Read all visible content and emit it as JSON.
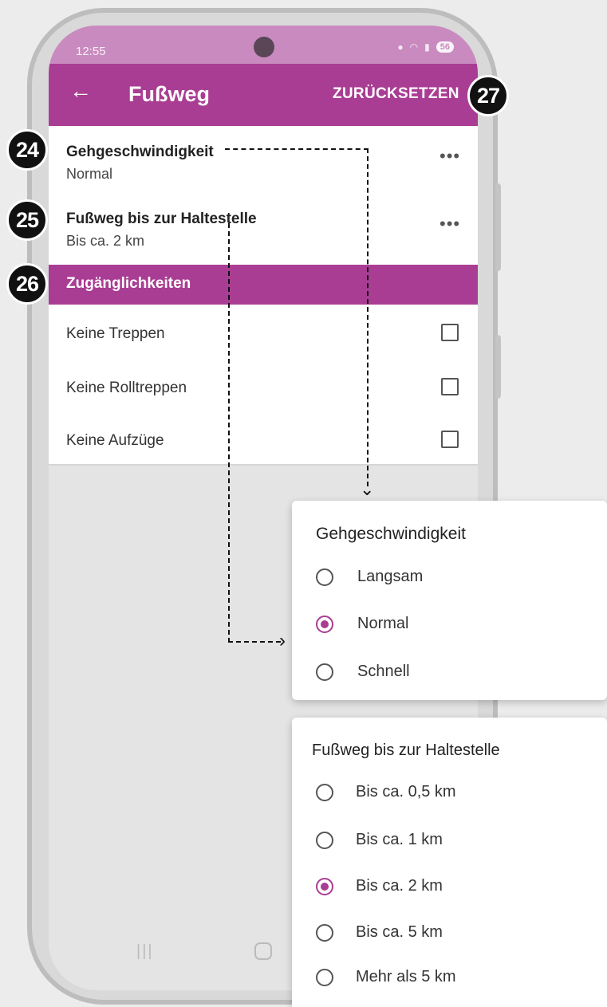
{
  "statusbar": {
    "time": "12:55",
    "battery": "56"
  },
  "appbar": {
    "back_icon": "arrow-left-icon",
    "title": "Fußweg",
    "reset_label": "ZURÜCKSETZEN"
  },
  "settings": {
    "walking_speed": {
      "title": "Gehgeschwindigkeit",
      "value": "Normal"
    },
    "walk_distance": {
      "title": "Fußweg bis zur Haltestelle",
      "value": "Bis ca. 2 km"
    }
  },
  "accessibility": {
    "section_title": "Zugänglichkeiten",
    "items": [
      {
        "label": "Keine Treppen",
        "checked": false
      },
      {
        "label": "Keine Rolltreppen",
        "checked": false
      },
      {
        "label": "Keine Aufzüge",
        "checked": false
      }
    ]
  },
  "badges": [
    "24",
    "25",
    "26",
    "27"
  ],
  "speed_dialog": {
    "title": "Gehgeschwindigkeit",
    "options": [
      "Langsam",
      "Normal",
      "Schnell"
    ],
    "selected": "Normal"
  },
  "distance_dialog": {
    "title": "Fußweg bis zur Haltestelle",
    "options": [
      "Bis ca. 0,5 km",
      "Bis ca. 1 km",
      "Bis ca. 2 km",
      "Bis ca. 5 km",
      "Mehr als 5 km"
    ],
    "selected": "Bis ca. 2 km"
  },
  "colors": {
    "accent": "#a93d93",
    "statusbar": "#c98bbf",
    "badge": "#111111"
  }
}
